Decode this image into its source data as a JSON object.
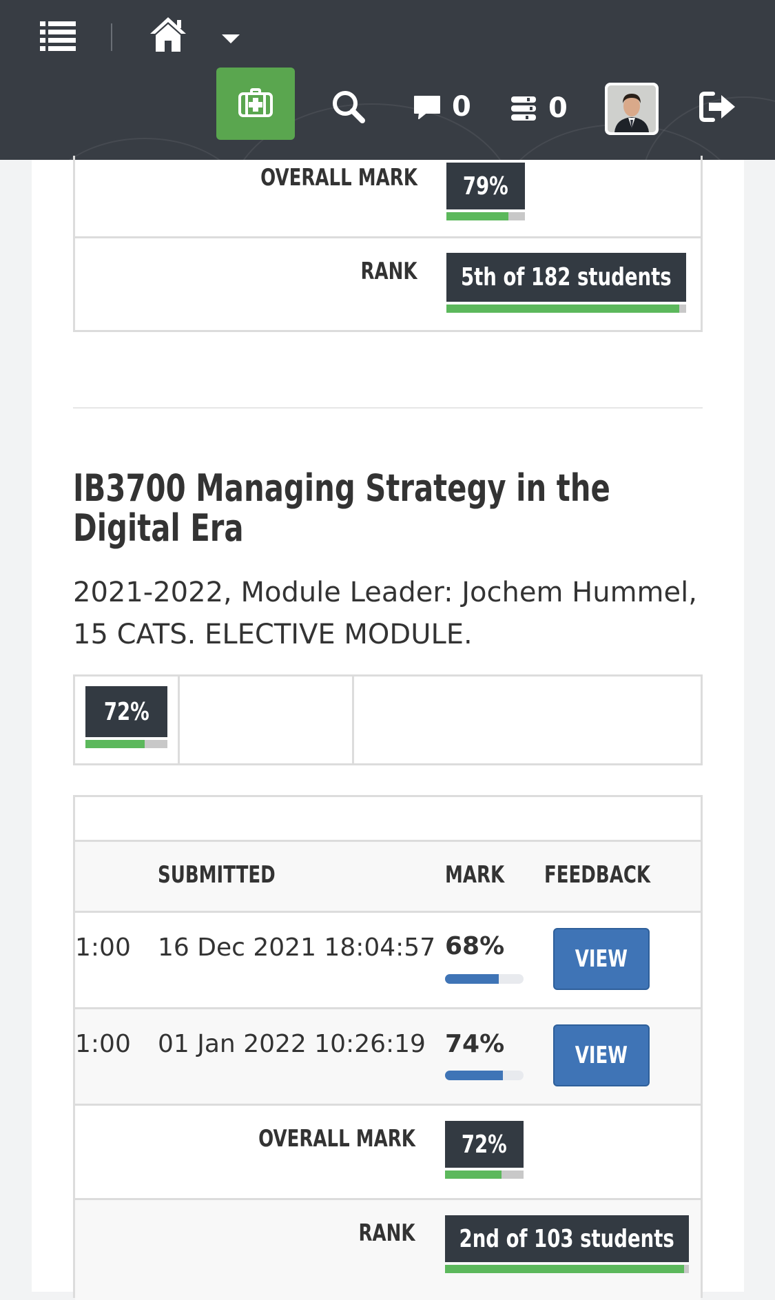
{
  "topbar": {
    "messages_count": "0",
    "tasks_count": "0"
  },
  "prev_module": {
    "overall_label": "OVERALL MARK",
    "overall_value": "79%",
    "overall_fraction": 0.79,
    "rank_label": "RANK",
    "rank_value": "5th of 182 students",
    "rank_fraction": 0.97
  },
  "module": {
    "title": "IB3700 Managing Strategy in the Digital Era",
    "subtitle": "2021-2022, Module Leader: Jochem Hummel, 15 CATS. ELECTIVE MODULE.",
    "summary_mark": "72%",
    "summary_fraction": 0.72,
    "headers": {
      "submitted": "SUBMITTED",
      "mark": "MARK",
      "feedback": "FEEDBACK"
    },
    "rows": [
      {
        "time": "1:00",
        "submitted": "16 Dec 2021 18:04:57",
        "mark": "68%",
        "mark_fraction": 0.68,
        "action": "VIEW"
      },
      {
        "time": "1:00",
        "submitted": "01 Jan 2022 10:26:19",
        "mark": "74%",
        "mark_fraction": 0.74,
        "action": "VIEW"
      }
    ],
    "overall_label": "OVERALL MARK",
    "overall_value": "72%",
    "overall_fraction": 0.72,
    "rank_label": "RANK",
    "rank_value": "2nd of 103 students",
    "rank_fraction": 0.98
  },
  "colors": {
    "topbar_bg": "#383d44",
    "accent_green": "#5aa64f",
    "mark_box": "#333a42",
    "progress_green": "#5cb85c",
    "progress_blue": "#3f74b6",
    "button_blue": "#3f74b6"
  },
  "icons": [
    "list-icon",
    "home-icon",
    "caret-down-icon",
    "medical-kit-icon",
    "search-icon",
    "comment-icon",
    "tasks-icon",
    "logout-icon"
  ]
}
